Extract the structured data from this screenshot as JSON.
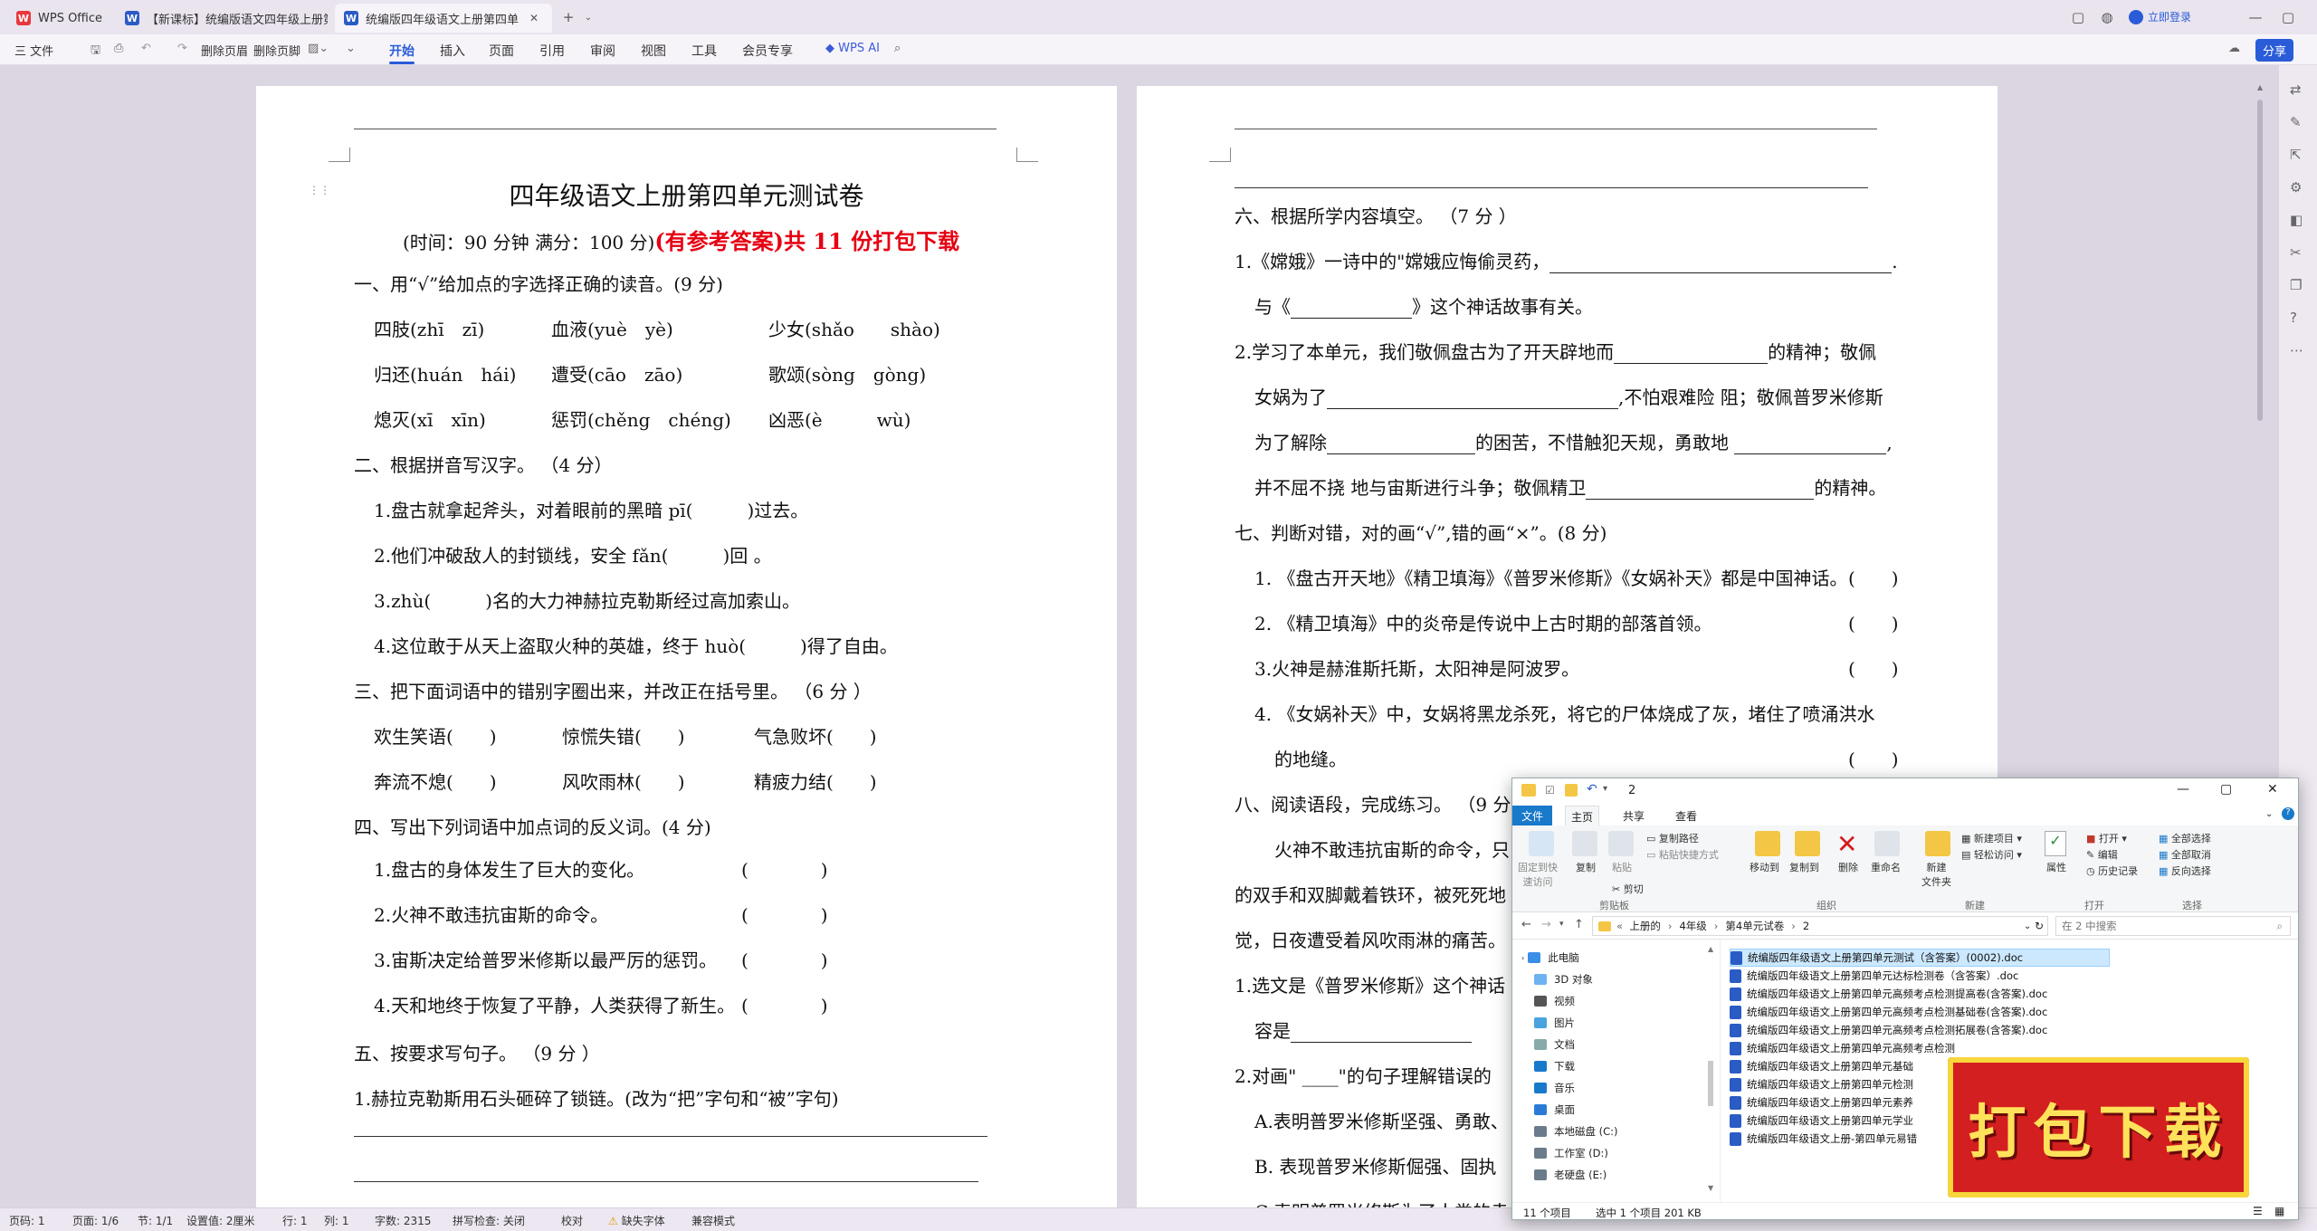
{
  "titlebar": {
    "tabs": [
      {
        "label": "WPS Office",
        "icon": "wps-logo"
      },
      {
        "label": "【新课标】统编版语文四年级上册第",
        "icon": "W"
      },
      {
        "label": "统编版四年级语文上册第四单",
        "icon": "W"
      }
    ],
    "login": "立即登录"
  },
  "ribbon": {
    "file": "三 文件",
    "delete_header": "删除页眉",
    "delete_footer": "删除页脚",
    "menus": [
      "开始",
      "插入",
      "页面",
      "引用",
      "审阅",
      "视图",
      "工具",
      "会员专享"
    ],
    "active_menu": "开始",
    "ai": "WPS AI",
    "share": "分享"
  },
  "left_page": {
    "title": "四年级语文上册第四单元测试卷",
    "subtitle_black": "(时间：90 分钟  满分：100 分)",
    "subtitle_red": "(有参考答案)共 11 份打包下载",
    "s1": "一、用“√”给加点的字选择正确的读音。(9 分)",
    "s1_rows": [
      [
        "四肢(zhī　zī)",
        "血液(yuè　yè)",
        "少女(shǎo　　shào)"
      ],
      [
        "归还(huán　hái)",
        "遭受(cāo　zāo)",
        "歌颂(sòng　gòng)"
      ],
      [
        "熄灭(xī　xīn)",
        "惩罚(chěng　chéng)",
        "凶恶(è　　　wù)"
      ]
    ],
    "s2": "二、根据拼音写汉字。 （4 分）",
    "s2_items": [
      "1.盘古就拿起斧头，对着眼前的黑暗  pī(　　　)过去。",
      "2.他们冲破敌人的封锁线，安全 fǎn(　　　)回 。",
      "3.zhù(　　　)名的大力神赫拉克勒斯经过高加索山。",
      "4.这位敢于从天上盗取火种的英雄，终于 huò(　　　)得了自由。"
    ],
    "s3": "三、把下面词语中的错别字圈出来，并改正在括号里。 （6 分 ）",
    "s3_rows": [
      [
        "欢生笑语(　　)",
        "惊慌失错(　　)",
        "气急败坏(　　)"
      ],
      [
        "奔流不熄(　　)",
        "风吹雨林(　　)",
        "精疲力结(　　)"
      ]
    ],
    "s4": "四、写出下列词语中加点词的反义词。(4 分)",
    "s4_items": [
      [
        "1.盘古的身体发生了巨大的变化。",
        "(　　　　)"
      ],
      [
        "2.火神不敢违抗宙斯的命令。",
        "(　　　　)"
      ],
      [
        "3.宙斯决定给普罗米修斯以最严厉的惩罚。",
        "(　　　　)"
      ],
      [
        "4.天和地终于恢复了平静，人类获得了新生。",
        "(　　　　)"
      ]
    ],
    "s5": "五、按要求写句子。 （9 分 ）",
    "s5_item1": "1.赫拉克勒斯用石头砸碎了锁链。(改为“把”字句和“被”字句)"
  },
  "right_page": {
    "s6": "六、根据所学内容填空。 （7 分 ）",
    "s6_1a": "1.《嫦娥》一诗中的\"嫦娥应悔偷灵药，",
    "s6_1b": "与《",
    "s6_1c": "》这个神话故事有关。",
    "s6_2a": "2.学习了本单元，我们敬佩盘古为了开天辟地而",
    "s6_2b": "的精神；敬佩",
    "s6_2c": "女娲为了",
    "s6_2d": ",不怕艰难险  阻；敬佩普罗米修斯",
    "s6_2e": "为了解除",
    "s6_2f": "的困苦，不惜触犯天规，勇敢地",
    "s6_2g": "并不屈不挠  地与宙斯进行斗争；敬佩精卫",
    "s6_2h": "的精神。",
    "s7": "七、判断对错，对的画“√”,错的画“×”。(8 分)",
    "s7_items": [
      [
        "1. 《盘古开天地》《精卫填海》《普罗米修斯》《女娲补天》都是中国神话。",
        "(　　)"
      ],
      [
        "2. 《精卫填海》中的炎帝是传说中上古时期的部落首领。",
        "(　　)"
      ],
      [
        "3.火神是赫淮斯托斯，太阳神是阿波罗。",
        "(　　)"
      ],
      [
        "4. 《女娲补天》中，女娲将黑龙杀死，将它的尸体烧成了灰，堵住了喷涌洪水",
        ""
      ]
    ],
    "s7_4b": "的地缝。",
    "s7_4b_paren": "(　　)",
    "s8": "八、阅读语段，完成练习。 （9 分",
    "s8_p1": "火神不敢违抗宙斯的命令，只",
    "s8_p2": "的双手和双脚戴着铁环，被死死地",
    "s8_p3": "觉，日夜遭受着风吹雨淋的痛苦。",
    "s8_q1": "1.选文是《普罗米修斯》这个神话",
    "s8_q1b": "容是",
    "s8_q2": "2.对画\"  ____\"的句子理解错误的",
    "s8_A": "A.表明普罗米修斯坚强、勇敢、",
    "s8_B": "B.  表现普罗米修斯倔强、固执",
    "s8_C": "C.表明普罗米修斯为了人类的幸"
  },
  "statusbar": {
    "items": [
      "页码: 1",
      "页面: 1/6",
      "节: 1/1",
      "设置值: 2厘米",
      "行: 1",
      "列: 1",
      "字数: 2315",
      "拼写检查: 关闭",
      "校对",
      "缺失字体",
      "兼容模式"
    ]
  },
  "explorer": {
    "title": "2",
    "tabs": [
      "文件",
      "主页",
      "共享",
      "查看"
    ],
    "ribbon": {
      "pin": "固定到快\n速访问",
      "copy": "复制",
      "paste": "粘贴",
      "copy_path": "复制路径",
      "paste_shortcut": "粘贴快捷方式",
      "cut": "剪切",
      "clipboard": "剪贴板",
      "move_to": "移动到",
      "copy_to": "复制到",
      "delete": "删除",
      "rename": "重命名",
      "organize": "组织",
      "new_folder": "新建\n文件夹",
      "new_item": "新建项目",
      "easy_access": "轻松访问",
      "new": "新建",
      "properties": "属性",
      "open": "打开",
      "edit": "编辑",
      "history": "历史记录",
      "open_group": "打开",
      "select_all": "全部选择",
      "select_none": "全部取消",
      "invert": "反向选择",
      "select_group": "选择"
    },
    "breadcrumb": [
      "上册的",
      "4年级",
      "第4单元试卷",
      "2"
    ],
    "search_placeholder": "在 2 中搜索",
    "nav": [
      "此电脑",
      "3D 对象",
      "视频",
      "图片",
      "文档",
      "下载",
      "音乐",
      "桌面",
      "本地磁盘 (C:)",
      "工作室 (D:)",
      "老硬盘 (E:)"
    ],
    "files": [
      "统编版四年级语文上册第四单元测试（含答案）(0002).doc",
      "统编版四年级语文上册第四单元达标检测卷（含答案）.doc",
      "统编版四年级语文上册第四单元高频考点检测提高卷(含答案).doc",
      "统编版四年级语文上册第四单元高频考点检测基础卷(含答案).doc",
      "统编版四年级语文上册第四单元高频考点检测拓展卷(含答案).doc",
      "统编版四年级语文上册第四单元高频考点检测",
      "统编版四年级语文上册第四单元基础",
      "统编版四年级语文上册第四单元检测",
      "统编版四年级语文上册第四单元素养",
      "统编版四年级语文上册第四单元学业",
      "统编版四年级语文上册-第四单元易错"
    ],
    "status_count": "11 个项目",
    "status_sel": "选中 1 个项目  201 KB"
  },
  "promo": {
    "text": "打包下载"
  }
}
